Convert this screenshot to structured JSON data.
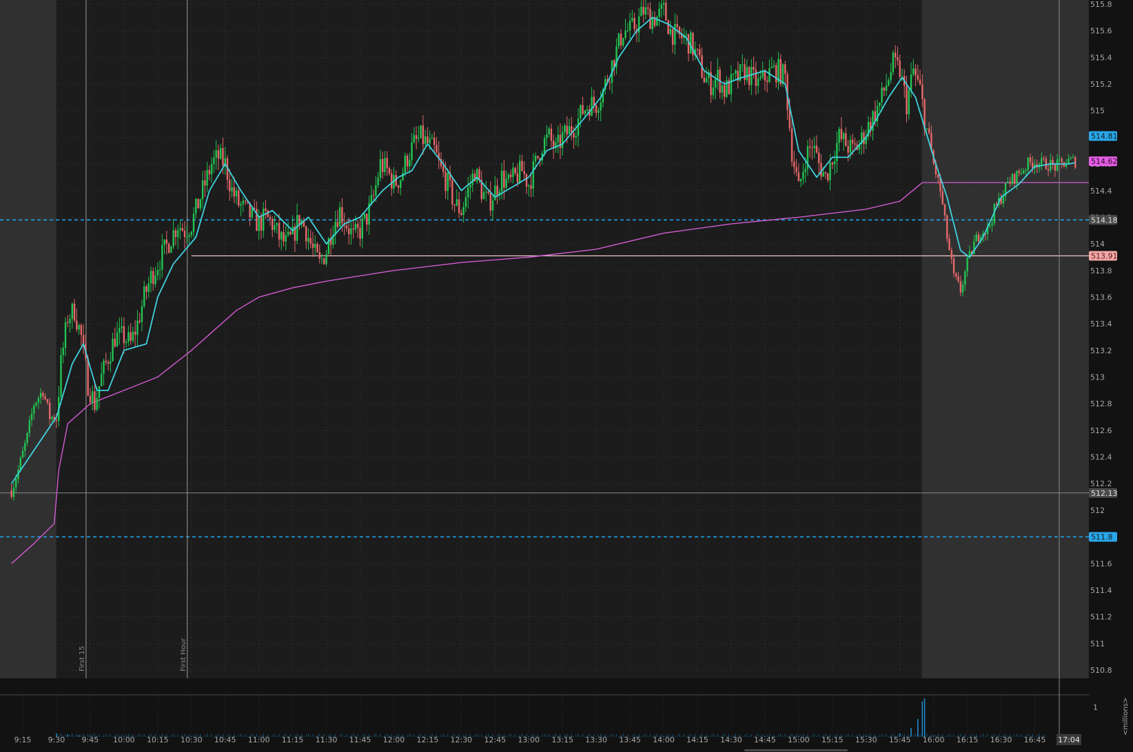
{
  "colors": {
    "background": "#121212",
    "session_background": "#1c1c1c",
    "extended_hours_background": "#303030",
    "grid": "#3a3a3a",
    "candle_up": "#22c552",
    "candle_down": "#e8696a",
    "ema_line": "#3fd3e0",
    "vwap_line": "#d25bd2",
    "level_line_blue": "#22a2e6",
    "level_line_pink": "#f4c8c8",
    "level_line_gray": "#8a8a8a",
    "volume_bar": "#1f88c8",
    "axis_text": "#a9a9a9"
  },
  "chart_data": {
    "type": "candlestick",
    "y_axis": {
      "ticks": [
        "515.8",
        "515.6",
        "515.4",
        "515.2",
        "515",
        "514.8",
        "514.6",
        "514.4",
        "514.2",
        "514",
        "513.8",
        "513.6",
        "513.4",
        "513.2",
        "513",
        "512.8",
        "512.6",
        "512.4",
        "512.2",
        "512",
        "511.8",
        "511.6",
        "511.4",
        "511.2",
        "511",
        "510.8"
      ],
      "range": [
        510.8,
        515.8
      ]
    },
    "x_axis": {
      "ticks": [
        "9:15",
        "9:30",
        "9:45",
        "10:00",
        "10:15",
        "10:30",
        "10:45",
        "11:00",
        "11:15",
        "11:30",
        "11:45",
        "12:00",
        "12:15",
        "12:30",
        "12:45",
        "13:00",
        "13:15",
        "13:30",
        "13:45",
        "14:00",
        "14:15",
        "14:30",
        "14:45",
        "15:00",
        "15:15",
        "15:30",
        "15:45",
        "16:00",
        "16:15",
        "16:30",
        "16:45"
      ],
      "cursor_label": "17:04"
    },
    "markers": [
      {
        "label": "First 15",
        "time": "9:45"
      },
      {
        "label": "First Hour",
        "time": "10:30"
      }
    ],
    "price_tags": [
      {
        "label": "514.81",
        "value": 514.81,
        "style": "cyan"
      },
      {
        "label": "514.62",
        "value": 514.62,
        "style": "magenta"
      },
      {
        "label": "514.18",
        "value": 514.18,
        "style": "gray"
      },
      {
        "label": "513.91",
        "value": 513.91,
        "style": "pink"
      },
      {
        "label": "512.13",
        "value": 512.13,
        "style": "gray"
      },
      {
        "label": "511.8",
        "value": 511.8,
        "style": "cyan"
      }
    ],
    "levels": [
      {
        "value": 514.18,
        "style": "dashed-blue"
      },
      {
        "value": 511.8,
        "style": "dashed-blue"
      },
      {
        "value": 513.91,
        "style": "solid-pink",
        "from_time": "10:30"
      },
      {
        "value": 512.13,
        "style": "solid-gray"
      },
      {
        "value": 514.46,
        "style": "solid-magenta",
        "from_time": "15:55"
      }
    ],
    "sessions": {
      "regular_start": "9:30",
      "regular_end": "16:00"
    },
    "price_path": [
      [
        "9:10",
        512.15
      ],
      [
        "9:13",
        512.3
      ],
      [
        "9:17",
        512.55
      ],
      [
        "9:20",
        512.8
      ],
      [
        "9:24",
        512.9
      ],
      [
        "9:27",
        512.7
      ],
      [
        "9:30",
        512.7
      ],
      [
        "9:32",
        513.1
      ],
      [
        "9:35",
        513.45
      ],
      [
        "9:38",
        513.5
      ],
      [
        "9:41",
        513.3
      ],
      [
        "9:44",
        512.95
      ],
      [
        "9:47",
        512.8
      ],
      [
        "9:50",
        513.0
      ],
      [
        "9:53",
        513.15
      ],
      [
        "9:56",
        513.3
      ],
      [
        "10:00",
        513.3
      ],
      [
        "10:03",
        513.25
      ],
      [
        "10:06",
        513.4
      ],
      [
        "10:09",
        513.6
      ],
      [
        "10:12",
        513.75
      ],
      [
        "10:15",
        513.85
      ],
      [
        "10:18",
        513.95
      ],
      [
        "10:21",
        514.05
      ],
      [
        "10:24",
        514.15
      ],
      [
        "10:27",
        514.1
      ],
      [
        "10:30",
        514.15
      ],
      [
        "10:33",
        514.3
      ],
      [
        "10:36",
        514.45
      ],
      [
        "10:39",
        514.6
      ],
      [
        "10:42",
        514.65
      ],
      [
        "10:45",
        514.6
      ],
      [
        "10:48",
        514.4
      ],
      [
        "10:51",
        514.3
      ],
      [
        "10:54",
        514.25
      ],
      [
        "10:57",
        514.2
      ],
      [
        "11:00",
        514.15
      ],
      [
        "11:03",
        514.2
      ],
      [
        "11:06",
        514.15
      ],
      [
        "11:09",
        514.05
      ],
      [
        "11:12",
        514.0
      ],
      [
        "11:15",
        514.05
      ],
      [
        "11:18",
        514.2
      ],
      [
        "11:21",
        514.1
      ],
      [
        "11:24",
        513.95
      ],
      [
        "11:27",
        513.85
      ],
      [
        "11:30",
        513.95
      ],
      [
        "11:33",
        514.15
      ],
      [
        "11:36",
        514.25
      ],
      [
        "11:39",
        514.15
      ],
      [
        "11:42",
        514.05
      ],
      [
        "11:45",
        514.1
      ],
      [
        "11:48",
        514.2
      ],
      [
        "11:51",
        514.35
      ],
      [
        "11:54",
        514.6
      ],
      [
        "11:57",
        514.55
      ],
      [
        "12:00",
        514.45
      ],
      [
        "12:03",
        514.5
      ],
      [
        "12:06",
        514.65
      ],
      [
        "12:09",
        514.75
      ],
      [
        "12:12",
        514.8
      ],
      [
        "12:15",
        514.75
      ],
      [
        "12:18",
        514.7
      ],
      [
        "12:21",
        514.55
      ],
      [
        "12:24",
        514.45
      ],
      [
        "12:27",
        514.3
      ],
      [
        "12:30",
        514.25
      ],
      [
        "12:33",
        514.4
      ],
      [
        "12:36",
        514.55
      ],
      [
        "12:39",
        514.4
      ],
      [
        "12:42",
        514.3
      ],
      [
        "12:45",
        514.4
      ],
      [
        "12:48",
        514.5
      ],
      [
        "12:51",
        514.45
      ],
      [
        "12:54",
        514.5
      ],
      [
        "12:57",
        514.55
      ],
      [
        "13:00",
        514.45
      ],
      [
        "13:03",
        514.6
      ],
      [
        "13:06",
        514.75
      ],
      [
        "13:09",
        514.8
      ],
      [
        "13:12",
        514.7
      ],
      [
        "13:15",
        514.8
      ],
      [
        "13:18",
        514.85
      ],
      [
        "13:21",
        514.9
      ],
      [
        "13:24",
        515.0
      ],
      [
        "13:27",
        515.05
      ],
      [
        "13:30",
        515.05
      ],
      [
        "13:33",
        515.15
      ],
      [
        "13:36",
        515.3
      ],
      [
        "13:39",
        515.45
      ],
      [
        "13:42",
        515.6
      ],
      [
        "13:45",
        515.6
      ],
      [
        "13:48",
        515.65
      ],
      [
        "13:51",
        515.75
      ],
      [
        "13:54",
        515.7
      ],
      [
        "13:57",
        515.7
      ],
      [
        "14:00",
        515.75
      ],
      [
        "14:03",
        515.6
      ],
      [
        "14:06",
        515.55
      ],
      [
        "14:09",
        515.55
      ],
      [
        "14:12",
        515.5
      ],
      [
        "14:15",
        515.4
      ],
      [
        "14:18",
        515.25
      ],
      [
        "14:21",
        515.2
      ],
      [
        "14:24",
        515.25
      ],
      [
        "14:27",
        515.15
      ],
      [
        "14:30",
        515.2
      ],
      [
        "14:33",
        515.25
      ],
      [
        "14:36",
        515.3
      ],
      [
        "14:39",
        515.25
      ],
      [
        "14:42",
        515.2
      ],
      [
        "14:45",
        515.25
      ],
      [
        "14:48",
        515.3
      ],
      [
        "14:51",
        515.3
      ],
      [
        "14:54",
        515.25
      ],
      [
        "14:57",
        514.7
      ],
      [
        "15:00",
        514.4
      ],
      [
        "15:03",
        514.65
      ],
      [
        "15:06",
        514.75
      ],
      [
        "15:09",
        514.6
      ],
      [
        "15:12",
        514.5
      ],
      [
        "15:15",
        514.65
      ],
      [
        "15:18",
        514.8
      ],
      [
        "15:21",
        514.75
      ],
      [
        "15:24",
        514.7
      ],
      [
        "15:27",
        514.75
      ],
      [
        "15:30",
        514.85
      ],
      [
        "15:33",
        514.95
      ],
      [
        "15:36",
        515.05
      ],
      [
        "15:39",
        515.2
      ],
      [
        "15:42",
        515.35
      ],
      [
        "15:45",
        515.3
      ],
      [
        "15:48",
        515.05
      ],
      [
        "15:51",
        515.3
      ],
      [
        "15:54",
        515.15
      ],
      [
        "15:57",
        514.85
      ],
      [
        "16:00",
        514.6
      ],
      [
        "16:03",
        514.4
      ],
      [
        "16:06",
        514.05
      ],
      [
        "16:09",
        513.75
      ],
      [
        "16:12",
        513.65
      ],
      [
        "16:15",
        513.85
      ],
      [
        "16:18",
        514.0
      ],
      [
        "16:21",
        514.1
      ],
      [
        "16:24",
        514.1
      ],
      [
        "16:27",
        514.25
      ],
      [
        "16:30",
        514.35
      ],
      [
        "16:33",
        514.45
      ],
      [
        "16:36",
        514.5
      ],
      [
        "16:39",
        514.55
      ],
      [
        "16:42",
        514.6
      ],
      [
        "16:45",
        514.62
      ],
      [
        "16:48",
        514.6
      ],
      [
        "16:51",
        514.6
      ],
      [
        "16:54",
        514.58
      ],
      [
        "16:57",
        514.6
      ],
      [
        "17:00",
        514.62
      ],
      [
        "17:03",
        514.62
      ]
    ],
    "ema": [
      [
        "9:10",
        512.2
      ],
      [
        "9:20",
        512.45
      ],
      [
        "9:30",
        512.7
      ],
      [
        "9:37",
        513.1
      ],
      [
        "9:42",
        513.25
      ],
      [
        "9:48",
        512.9
      ],
      [
        "9:53",
        512.9
      ],
      [
        "10:00",
        513.2
      ],
      [
        "10:10",
        513.25
      ],
      [
        "10:15",
        513.6
      ],
      [
        "10:22",
        513.85
      ],
      [
        "10:32",
        514.05
      ],
      [
        "10:38",
        514.4
      ],
      [
        "10:45",
        514.6
      ],
      [
        "10:52",
        514.4
      ],
      [
        "11:00",
        514.2
      ],
      [
        "11:06",
        514.25
      ],
      [
        "11:15",
        514.1
      ],
      [
        "11:22",
        514.2
      ],
      [
        "11:30",
        514.0
      ],
      [
        "11:38",
        514.15
      ],
      [
        "11:45",
        514.2
      ],
      [
        "11:55",
        514.4
      ],
      [
        "12:02",
        514.5
      ],
      [
        "12:08",
        514.55
      ],
      [
        "12:15",
        514.75
      ],
      [
        "12:22",
        514.6
      ],
      [
        "12:30",
        514.4
      ],
      [
        "12:37",
        514.5
      ],
      [
        "12:45",
        514.35
      ],
      [
        "12:55",
        514.45
      ],
      [
        "13:00",
        514.5
      ],
      [
        "13:08",
        514.7
      ],
      [
        "13:15",
        514.75
      ],
      [
        "13:25",
        514.95
      ],
      [
        "13:32",
        515.1
      ],
      [
        "13:40",
        515.4
      ],
      [
        "13:48",
        515.6
      ],
      [
        "13:55",
        515.7
      ],
      [
        "14:02",
        515.65
      ],
      [
        "14:10",
        515.55
      ],
      [
        "14:18",
        515.3
      ],
      [
        "14:27",
        515.2
      ],
      [
        "14:35",
        515.25
      ],
      [
        "14:45",
        515.3
      ],
      [
        "14:54",
        515.2
      ],
      [
        "15:00",
        514.7
      ],
      [
        "15:08",
        514.5
      ],
      [
        "15:15",
        514.65
      ],
      [
        "15:22",
        514.65
      ],
      [
        "15:30",
        514.8
      ],
      [
        "15:40",
        515.1
      ],
      [
        "15:46",
        515.25
      ],
      [
        "15:52",
        515.1
      ],
      [
        "16:00",
        514.65
      ],
      [
        "16:06",
        514.35
      ],
      [
        "16:12",
        513.95
      ],
      [
        "16:16",
        513.9
      ],
      [
        "16:22",
        514.05
      ],
      [
        "16:30",
        514.35
      ],
      [
        "16:38",
        514.45
      ],
      [
        "16:45",
        514.58
      ],
      [
        "16:52",
        514.6
      ],
      [
        "17:00",
        514.6
      ],
      [
        "17:03",
        514.61
      ]
    ],
    "vwap": [
      [
        "9:10",
        511.6
      ],
      [
        "9:20",
        511.75
      ],
      [
        "9:29",
        511.9
      ],
      [
        "9:31",
        512.3
      ],
      [
        "9:35",
        512.65
      ],
      [
        "9:45",
        512.8
      ],
      [
        "10:00",
        512.9
      ],
      [
        "10:15",
        513.0
      ],
      [
        "10:30",
        513.2
      ],
      [
        "10:40",
        513.35
      ],
      [
        "10:50",
        513.5
      ],
      [
        "11:00",
        513.6
      ],
      [
        "11:15",
        513.67
      ],
      [
        "11:30",
        513.72
      ],
      [
        "12:00",
        513.8
      ],
      [
        "12:30",
        513.86
      ],
      [
        "13:00",
        513.9
      ],
      [
        "13:30",
        513.96
      ],
      [
        "14:00",
        514.08
      ],
      [
        "14:30",
        514.15
      ],
      [
        "15:00",
        514.2
      ],
      [
        "15:30",
        514.26
      ],
      [
        "15:45",
        514.32
      ],
      [
        "15:55",
        514.46
      ]
    ],
    "volume": {
      "axis_label": "<millions>",
      "ticks": [
        "1"
      ],
      "range": [
        0,
        1.3
      ],
      "bars": [
        [
          "9:30",
          0.12
        ],
        [
          "9:35",
          0.08
        ],
        [
          "9:40",
          0.06
        ],
        [
          "9:45",
          0.05
        ],
        [
          "10:00",
          0.04
        ],
        [
          "10:30",
          0.03
        ],
        [
          "11:00",
          0.02
        ],
        [
          "12:00",
          0.02
        ],
        [
          "13:00",
          0.02
        ],
        [
          "14:00",
          0.03
        ],
        [
          "14:45",
          0.03
        ],
        [
          "15:00",
          0.04
        ],
        [
          "15:30",
          0.05
        ],
        [
          "15:45",
          0.12
        ],
        [
          "15:50",
          0.3
        ],
        [
          "15:53",
          0.6
        ],
        [
          "15:55",
          1.2
        ],
        [
          "15:56",
          1.3
        ],
        [
          "16:00",
          0.05
        ],
        [
          "16:30",
          0.02
        ]
      ]
    }
  }
}
